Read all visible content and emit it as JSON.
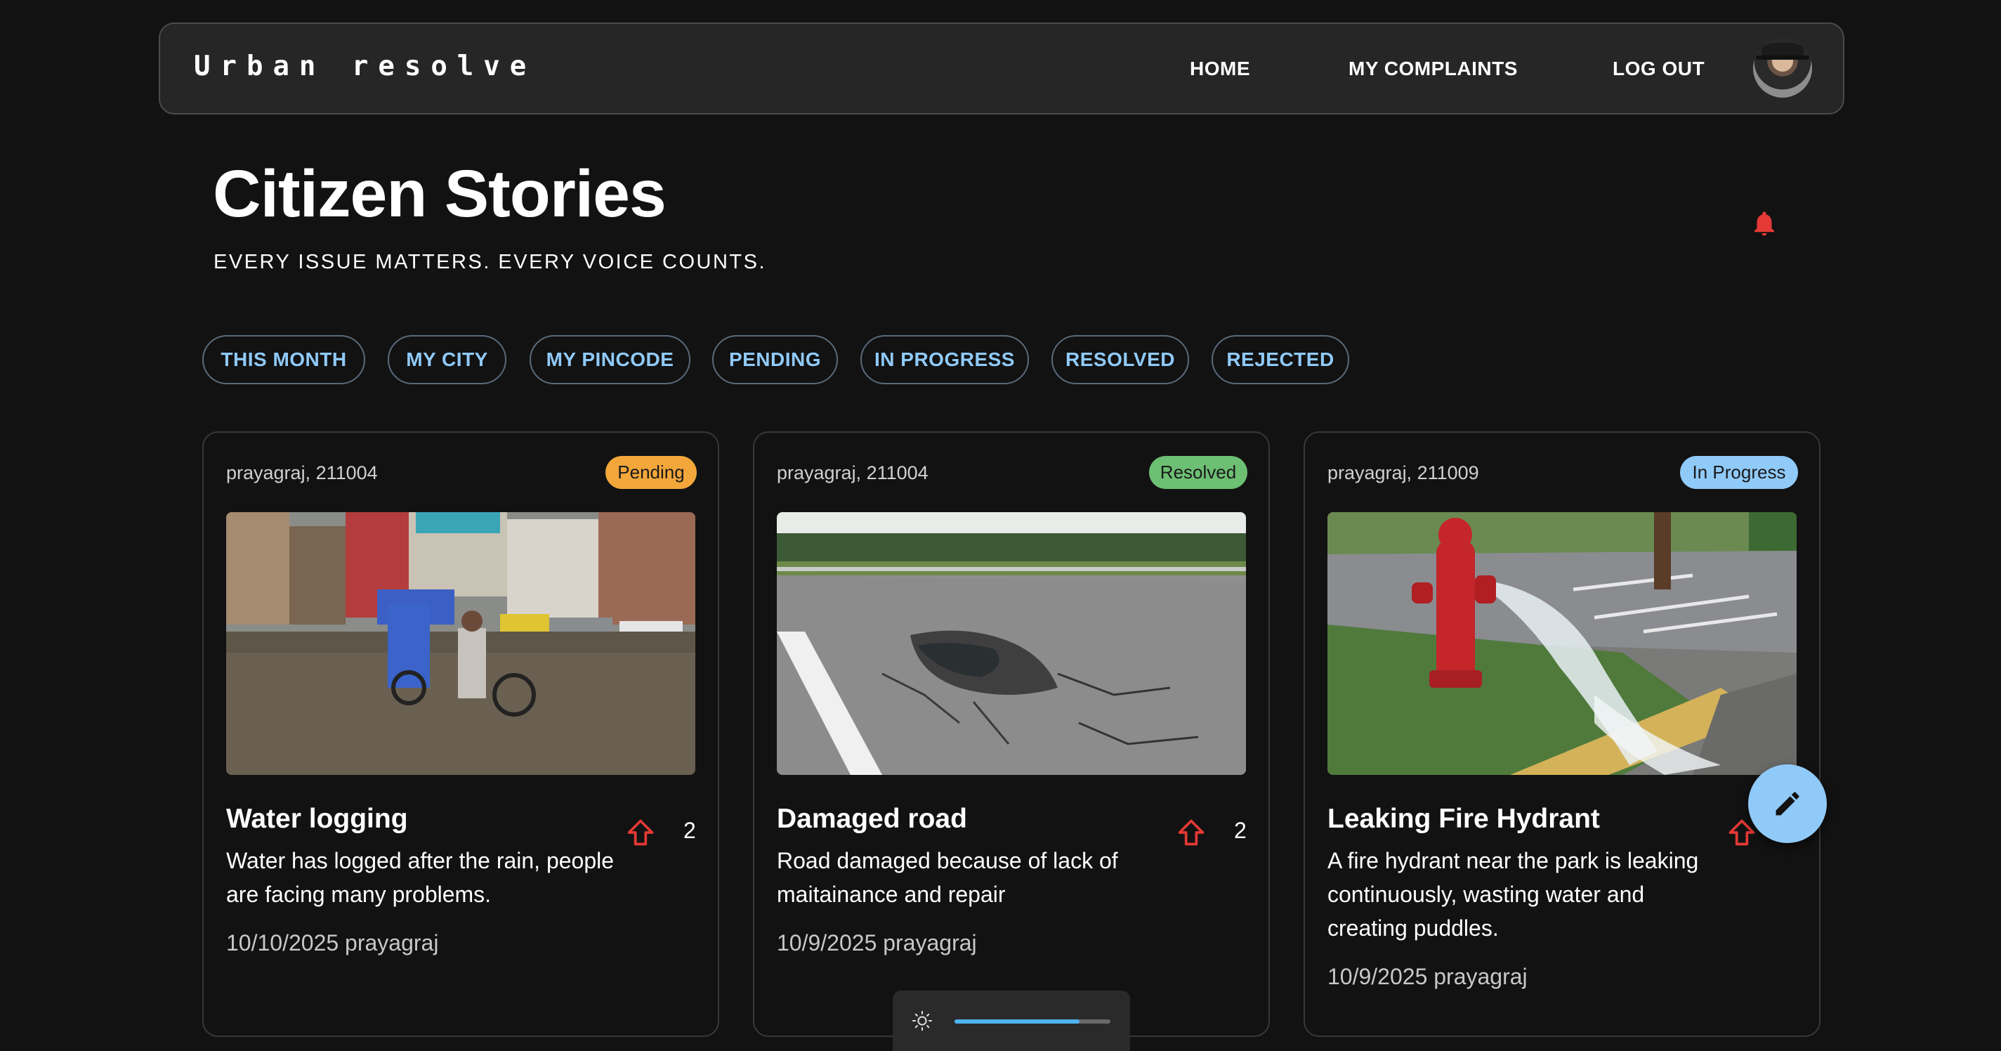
{
  "navbar": {
    "brand": "Urban resolve",
    "links": {
      "home": "HOME",
      "complaints": "MY COMPLAINTS",
      "logout": "LOG OUT"
    }
  },
  "header": {
    "title": "Citizen Stories",
    "subtitle": "EVERY ISSUE MATTERS. EVERY VOICE COUNTS."
  },
  "filters": [
    "THIS MONTH",
    "MY CITY",
    "MY PINCODE",
    "PENDING",
    "IN PROGRESS",
    "RESOLVED",
    "REJECTED"
  ],
  "cards": [
    {
      "location": "prayagraj, 211004",
      "status": "Pending",
      "status_color": "#f3a73b",
      "image": "flooded-street-photo",
      "title": "Water logging",
      "description": "Water has logged after the rain, people are facing many problems.",
      "date": "10/10/2025 prayagraj",
      "upvotes": "2"
    },
    {
      "location": "prayagraj, 211004",
      "status": "Resolved",
      "status_color": "#6cbf73",
      "image": "damaged-road-photo",
      "title": "Damaged road",
      "description": "Road damaged because of lack of maitainance and repair",
      "date": "10/9/2025 prayagraj",
      "upvotes": "2"
    },
    {
      "location": "prayagraj, 211009",
      "status": "In Progress",
      "status_color": "#90caf9",
      "image": "leaking-fire-hydrant-photo",
      "title": "Leaking Fire Hydrant",
      "description": "A fire hydrant near the park is leaking continuously, wasting water and creating puddles.",
      "date": "10/9/2025 prayagraj",
      "upvotes": ""
    }
  ],
  "icons": {
    "notification": "bell-icon",
    "upvote": "arrow-up-outline-icon",
    "fab": "pencil-icon",
    "brightness": "sun-icon"
  },
  "colors": {
    "background": "#121212",
    "accent": "#90caf9",
    "notification": "#e53935",
    "upvote": "#e53935"
  },
  "brightness_level": 0.8
}
